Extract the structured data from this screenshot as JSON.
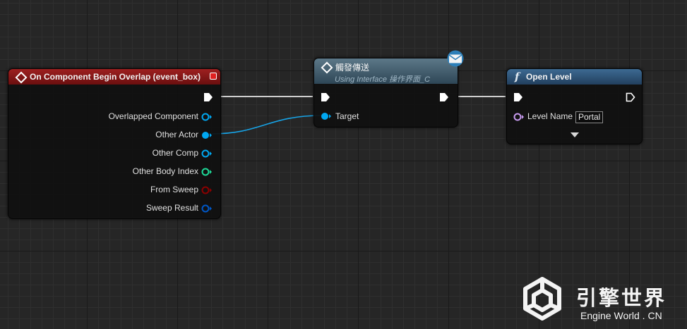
{
  "nodes": {
    "overlap_event": {
      "title": "On Component Begin Overlap (event_box)",
      "pins": {
        "overlapped_component": "Overlapped Component",
        "other_actor": "Other Actor",
        "other_comp": "Other Comp",
        "other_body_index": "Other Body Index",
        "from_sweep": "From Sweep",
        "sweep_result": "Sweep Result"
      }
    },
    "interface_message": {
      "title": "觸發傳送",
      "subtitle": "Using Interface 操作界面_C",
      "pins": {
        "target": "Target"
      }
    },
    "open_level": {
      "title": "Open Level",
      "func_glyph": "f",
      "pins": {
        "level_name": "Level Name"
      },
      "level_name_value": "Portal"
    }
  },
  "watermark": {
    "title_cn": "引擎世界",
    "subtitle": "Engine World . CN"
  },
  "colors": {
    "event_header": "#8a1a1a",
    "interface_header": "#4a6676",
    "function_header": "#2f5578",
    "object_pin": "#00a8f2",
    "int_pin": "#1edc9a",
    "bool_pin": "#8c0000",
    "struct_pin": "#0058c8",
    "name_pin": "#c89bf0",
    "exec": "#ffffff"
  }
}
